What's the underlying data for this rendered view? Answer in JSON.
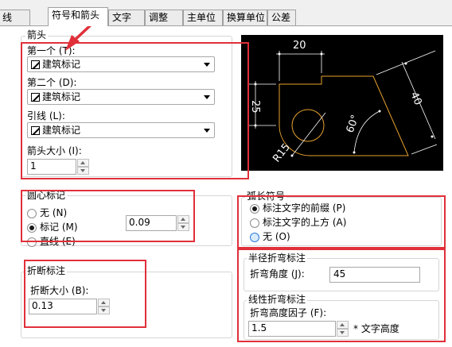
{
  "tabs": [
    "线",
    "符号和箭头",
    "文字",
    "调整",
    "主单位",
    "换算单位",
    "公差"
  ],
  "active_tab": "符号和箭头",
  "arrows": {
    "group_title": "箭头",
    "first_label": "第一个 (T):",
    "first_value": "建筑标记",
    "second_label": "第二个 (D):",
    "second_value": "建筑标记",
    "leader_label": "引线 (L):",
    "leader_value": "建筑标记",
    "size_label": "箭头大小 (I):",
    "size_value": "1"
  },
  "center_marks": {
    "group_title": "圆心标记",
    "options": [
      "无 (N)",
      "标记 (M)",
      "直线 (E)"
    ],
    "selected": "标记 (M)",
    "size_value": "0.09"
  },
  "dim_break": {
    "group_title": "折断标注",
    "size_label": "折断大小 (B):",
    "size_value": "0.13"
  },
  "arc_length": {
    "group_title": "弧长符号",
    "options": [
      "标注文字的前缀 (P)",
      "标注文字的上方 (A)",
      "无 (O)"
    ],
    "selected": "标注文字的前缀 (P)"
  },
  "radius_jog": {
    "group_title": "半径折弯标注",
    "angle_label": "折弯角度 (J):",
    "angle_value": "45"
  },
  "linear_jog": {
    "group_title": "线性折弯标注",
    "factor_label": "折弯高度因子 (F):",
    "factor_value": "1.5",
    "suffix": "* 文字高度"
  },
  "preview": {
    "dim_top": "20",
    "dim_left": "25",
    "dim_right": "40",
    "dim_angle": "60°",
    "dim_radius": "R15"
  },
  "colors": {
    "highlight": "#e0303a",
    "preview_bg": "#000000",
    "preview_geometry": "#e8a22e",
    "preview_dim": "#ffffff"
  }
}
